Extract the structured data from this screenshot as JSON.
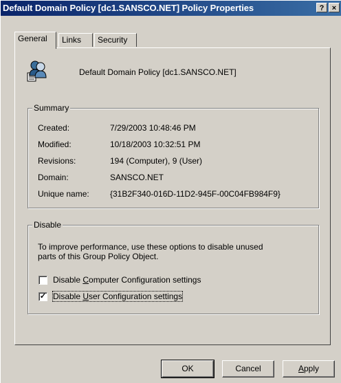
{
  "window": {
    "title": "Default Domain Policy [dc1.SANSCO.NET] Policy Properties",
    "help_label": "?",
    "close_label": "×"
  },
  "tabs": [
    {
      "label": "General"
    },
    {
      "label": "Links"
    },
    {
      "label": "Security"
    }
  ],
  "header": {
    "policy_name": "Default Domain Policy [dc1.SANSCO.NET]",
    "icon": "group-policy-users-icon"
  },
  "summary": {
    "title": "Summary",
    "rows": [
      {
        "label": "Created:",
        "value": "7/29/2003 10:48:46 PM"
      },
      {
        "label": "Modified:",
        "value": "10/18/2003 10:32:51 PM"
      },
      {
        "label": "Revisions:",
        "value": "194 (Computer), 9 (User)"
      },
      {
        "label": "Domain:",
        "value": "SANSCO.NET"
      },
      {
        "label": "Unique name:",
        "value": "{31B2F340-016D-11D2-945F-00C04FB984F9}"
      }
    ]
  },
  "disable": {
    "title": "Disable",
    "description_line1": "To improve performance, use these options to disable unused",
    "description_line2": "parts of this Group Policy Object.",
    "options": [
      {
        "label_pre": "Disable ",
        "label_accel": "C",
        "label_post": "omputer Configuration settings",
        "checked": false
      },
      {
        "label_pre": "Disable ",
        "label_accel": "U",
        "label_post": "ser Configuration settings",
        "checked": true
      }
    ]
  },
  "buttons": {
    "ok": "OK",
    "cancel": "Cancel",
    "apply_accel": "A",
    "apply_rest": "pply"
  }
}
